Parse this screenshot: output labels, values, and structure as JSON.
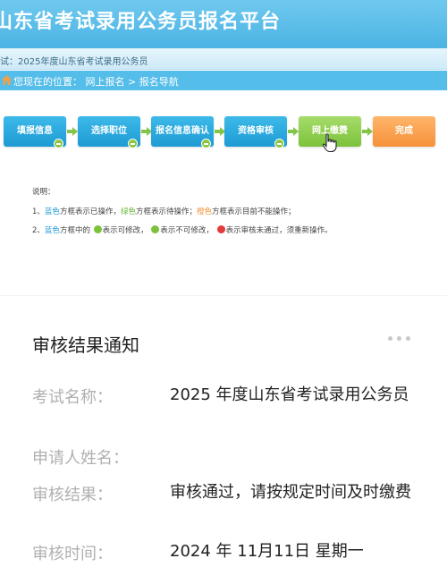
{
  "header": {
    "title": "山东省考试录用公务员报名平台"
  },
  "exam_bar": {
    "text": "试：2025年度山东省考试录用公务员"
  },
  "location_bar": {
    "home_icon": "home-icon",
    "text": "您现在的位置：  网上报名   >   报名导航"
  },
  "steps": [
    {
      "label": "填报信息",
      "state": "blue"
    },
    {
      "label": "选择职位",
      "state": "blue"
    },
    {
      "label": "报名信息确认",
      "state": "blue"
    },
    {
      "label": "资格审核",
      "state": "blue"
    },
    {
      "label": "网上缴费",
      "state": "green"
    },
    {
      "label": "完成",
      "state": "orange"
    }
  ],
  "notes": {
    "title": "说明：",
    "line1": {
      "num": "1、",
      "blue": "蓝色",
      "t1": "方框表示已操作，",
      "green": "绿色",
      "t2": "方框表示待操作；",
      "orange": "橙色",
      "t3": "方框表示目前不能操作；"
    },
    "line2": {
      "num": "2、",
      "blue": "蓝色",
      "t1": "方框中的",
      "t2": "表示可修改，",
      "t3": "表示不可修改，",
      "t4": "表示审核未通过，须重新操作。"
    }
  },
  "notice": {
    "title": "审核结果通知",
    "fields": [
      {
        "label": "考试名称：",
        "value": "2025 年度山东省考试录用公务员"
      },
      {
        "label": "申请人姓名：",
        "value": ""
      },
      {
        "label": "审核结果：",
        "value": "审核通过，请按规定时间及时缴费"
      },
      {
        "label": "审核时间：",
        "value": "2024 年 11月11日  星期一"
      }
    ]
  },
  "colors": {
    "blue": "#1e9ad6",
    "green": "#7cc23b",
    "orange": "#f6913a",
    "header": "#4cb3e4"
  }
}
